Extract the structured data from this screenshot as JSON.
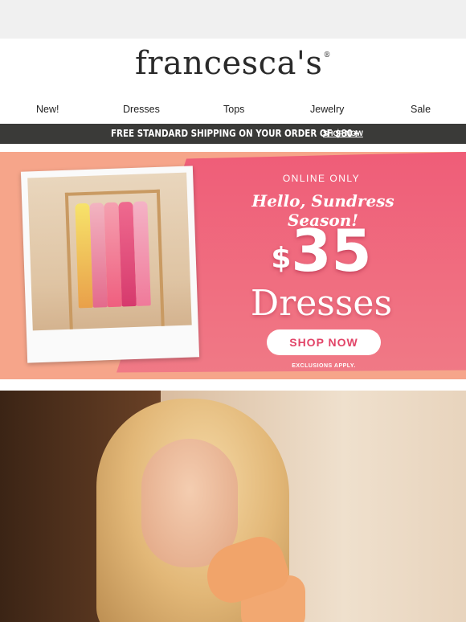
{
  "brand": {
    "name": "francesca's",
    "reg_mark": "®"
  },
  "nav": {
    "items": [
      "New!",
      "Dresses",
      "Tops",
      "Jewelry",
      "Sale"
    ]
  },
  "shipping_bar": {
    "text": "FREE STANDARD SHIPPING ON YOUR ORDER OF $80+",
    "link": "SHOP NOW"
  },
  "promo": {
    "tag": "ONLINE ONLY",
    "headline": "Hello, Sundress Season!",
    "currency": "$",
    "price": "35",
    "product": "Dresses",
    "cta": "SHOP NOW",
    "disclaimer": "EXCLUSIONS APPLY.",
    "colors": {
      "peach": "#f6a58a",
      "pink": "#ef5d78",
      "cta_text": "#e24468"
    }
  },
  "images": {
    "polaroid": "dress-rack-photo",
    "hero": "woman-in-orange-sundress-photo"
  }
}
